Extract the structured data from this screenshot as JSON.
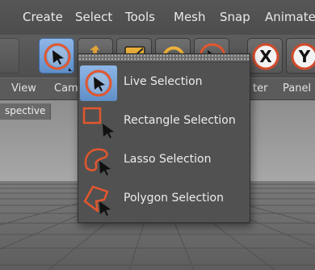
{
  "menubar": {
    "items": [
      "Create",
      "Select",
      "Tools",
      "Mesh",
      "Snap",
      "Animate"
    ]
  },
  "toolbar": {
    "buttons": [
      {
        "name": "live-selection-tool",
        "icon": "live-selection-icon",
        "active": true
      },
      {
        "name": "move-tool",
        "icon": "move-icon"
      },
      {
        "name": "scale-tool",
        "icon": "scale-icon"
      },
      {
        "name": "rotate-tool",
        "icon": "rotate-icon"
      },
      {
        "name": "recent-tool",
        "icon": "live-selection-icon"
      },
      {
        "name": "x-axis-lock",
        "icon": "x-axis-icon",
        "label": "X"
      },
      {
        "name": "y-axis-lock",
        "icon": "y-axis-icon",
        "label": "Y"
      }
    ]
  },
  "viewport_header": {
    "menus": [
      "View",
      "Cam",
      "ter",
      "Panel"
    ]
  },
  "viewport": {
    "label": "spective"
  },
  "popup": {
    "items": [
      {
        "label": "Live Selection",
        "icon": "live-selection-icon",
        "active": true
      },
      {
        "label": "Rectangle Selection",
        "icon": "rectangle-selection-icon"
      },
      {
        "label": "Lasso Selection",
        "icon": "lasso-selection-icon"
      },
      {
        "label": "Polygon Selection",
        "icon": "polygon-selection-icon"
      }
    ]
  },
  "colors": {
    "accent_blue": "#6f9fd8",
    "icon_orange": "#e2572e",
    "background": "#4a4a4a"
  }
}
